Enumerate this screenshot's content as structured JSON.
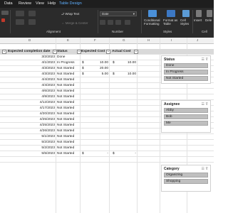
{
  "menubar": {
    "items": [
      "Data",
      "Review",
      "View",
      "Help",
      "Table Design"
    ]
  },
  "ribbon": {
    "wrap_text": "Wrap Text",
    "merge_center": "Merge & Center",
    "number_format": "Date",
    "alignment_label": "Alignment",
    "number_label": "Number",
    "styles_label": "Styles",
    "cells_label": "Cell",
    "conditional_formatting": "Conditional Formatting",
    "format_as_table": "Format as Table",
    "cell_styles": "Cell Styles",
    "insert": "Insert",
    "delete": "Dele"
  },
  "columns": [
    "D",
    "E",
    "F",
    "G",
    "H",
    "I",
    "J"
  ],
  "table": {
    "headers": {
      "due": "Expected completion date",
      "status": "Status",
      "expected_cost": "Expected Cost",
      "actual_cost": "Actual Cost"
    },
    "rows": [
      {
        "date": "3/2/2023",
        "status": "Done",
        "exp_sym": "",
        "exp": "",
        "act_sym": "",
        "act": ""
      },
      {
        "date": "4/1/2023",
        "status": "In Progress",
        "exp_sym": "$",
        "exp": "10.00",
        "act_sym": "$",
        "act": "10.00"
      },
      {
        "date": "4/3/2023",
        "status": "Not Started",
        "exp_sym": "$",
        "exp": "20.00",
        "act_sym": "",
        "act": ""
      },
      {
        "date": "4/3/2023",
        "status": "Not Started",
        "exp_sym": "$",
        "exp": "5.00",
        "act_sym": "$",
        "act": "10.00"
      },
      {
        "date": "4/4/2023",
        "status": "Not Started",
        "exp_sym": "",
        "exp": "",
        "act_sym": "",
        "act": ""
      },
      {
        "date": "4/4/2023",
        "status": "Not Started",
        "exp_sym": "",
        "exp": "",
        "act_sym": "",
        "act": ""
      },
      {
        "date": "4/6/2023",
        "status": "Not Started",
        "exp_sym": "",
        "exp": "",
        "act_sym": "",
        "act": ""
      },
      {
        "date": "4/9/2023",
        "status": "Not Started",
        "exp_sym": "",
        "exp": "",
        "act_sym": "",
        "act": ""
      },
      {
        "date": "4/12/2023",
        "status": "Not Started",
        "exp_sym": "",
        "exp": "",
        "act_sym": "",
        "act": ""
      },
      {
        "date": "4/17/2023",
        "status": "Not Started",
        "exp_sym": "",
        "exp": "",
        "act_sym": "",
        "act": ""
      },
      {
        "date": "4/20/2023",
        "status": "Not Started",
        "exp_sym": "",
        "exp": "",
        "act_sym": "",
        "act": ""
      },
      {
        "date": "4/25/2023",
        "status": "Not Started",
        "exp_sym": "",
        "exp": "",
        "act_sym": "",
        "act": ""
      },
      {
        "date": "4/25/2023",
        "status": "Not Started",
        "exp_sym": "",
        "exp": "",
        "act_sym": "",
        "act": ""
      },
      {
        "date": "4/26/2023",
        "status": "Not Started",
        "exp_sym": "",
        "exp": "",
        "act_sym": "",
        "act": ""
      },
      {
        "date": "5/1/2023",
        "status": "Not Started",
        "exp_sym": "",
        "exp": "",
        "act_sym": "",
        "act": ""
      },
      {
        "date": "5/2/2023",
        "status": "Not Started",
        "exp_sym": "",
        "exp": "",
        "act_sym": "",
        "act": ""
      },
      {
        "date": "5/2/2023",
        "status": "Not Started",
        "exp_sym": "",
        "exp": "",
        "act_sym": "",
        "act": ""
      },
      {
        "date": "5/5/2023",
        "status": "Not Started",
        "exp_sym": "$",
        "exp": "-",
        "act_sym": "$",
        "act": "-"
      }
    ]
  },
  "slicers": {
    "status": {
      "title": "Status",
      "items": [
        "Done",
        "In Progress",
        "Not Started"
      ]
    },
    "assignee": {
      "title": "Assignee",
      "items": [
        "Abby",
        "Bob",
        "Me"
      ]
    },
    "category": {
      "title": "Category",
      "items": [
        "Organizing",
        "Shopping"
      ]
    }
  },
  "colors": {
    "ribbon_bg": "#2b2b2b",
    "menubar_bg": "#1e1e1e",
    "accent": "#5fb0ff",
    "slicer_item": "#bfbfbf",
    "table_header": "#d9d9d9"
  }
}
